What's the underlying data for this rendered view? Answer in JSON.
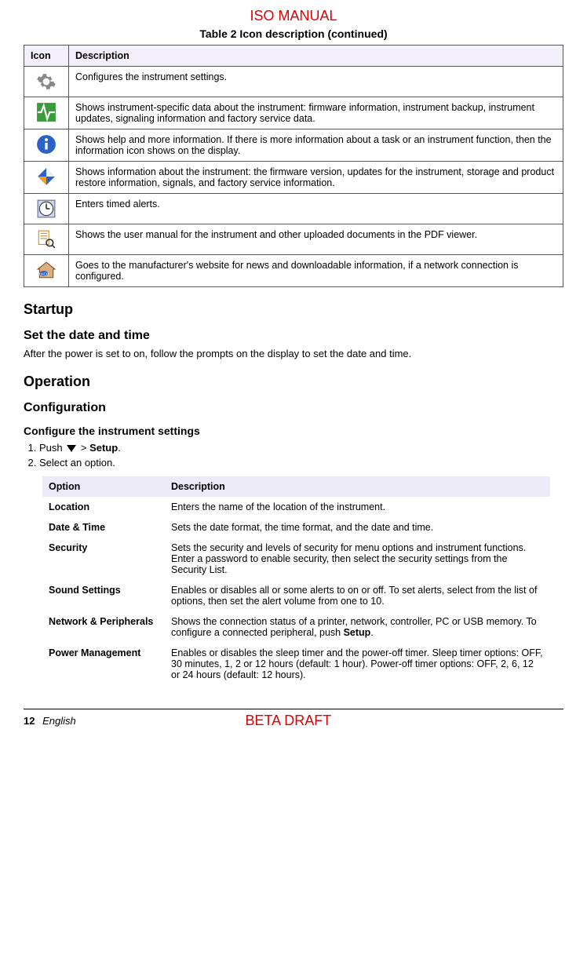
{
  "header": {
    "iso": "ISO MANUAL",
    "table_caption": "Table 2  Icon description (continued)"
  },
  "icon_table": {
    "headers": {
      "icon": "Icon",
      "desc": "Description"
    },
    "rows": [
      {
        "icon": "gear",
        "desc": "Configures the instrument settings."
      },
      {
        "icon": "activity",
        "desc": "Shows instrument-specific data about the instrument: firmware information, instrument backup, instrument updates, signaling information and factory service data."
      },
      {
        "icon": "info",
        "desc": "Shows help and more information. If there is more information about a task or an instrument function, then the information icon shows on the display."
      },
      {
        "icon": "diamond",
        "desc": "Shows information about the instrument: the firmware version, updates for the instrument, storage and product restore information, signals, and factory service information."
      },
      {
        "icon": "clock",
        "desc": "Enters timed alerts."
      },
      {
        "icon": "doc-search",
        "desc": "Shows the user manual for the instrument and other uploaded documents in the PDF viewer."
      },
      {
        "icon": "home",
        "desc": "Goes to the manufacturer's website for news and downloadable information, if a network connection is configured."
      }
    ]
  },
  "sections": {
    "startup": "Startup",
    "set_date_time": "Set the date and time",
    "set_date_time_body": "After the power is set to on, follow the prompts on the display to set the date and time.",
    "operation": "Operation",
    "configuration": "Configuration",
    "configure_settings": "Configure the instrument settings"
  },
  "steps": {
    "s1_pre": "Push ",
    "s1_post": " > ",
    "s1_bold": "Setup",
    "s1_end": ".",
    "s2": "Select an option."
  },
  "option_table": {
    "headers": {
      "option": "Option",
      "desc": "Description"
    },
    "rows": [
      {
        "option": "Location",
        "desc": "Enters the name of the location of the instrument."
      },
      {
        "option": "Date & Time",
        "desc": "Sets the date format, the time format, and the date and time."
      },
      {
        "option": "Security",
        "desc": "Sets the security and levels of security for menu options and instrument functions. Enter a password to enable security, then select the security settings from the Security List."
      },
      {
        "option": "Sound Settings",
        "desc": "Enables or disables all or some alerts to on or off. To set alerts, select from the list of options, then set the alert volume from one to 10."
      },
      {
        "option": "Network & Peripherals",
        "desc_pre": "Shows the connection status of a printer, network, controller, PC or USB memory. To configure a connected peripheral, push ",
        "desc_bold": "Setup",
        "desc_post": "."
      },
      {
        "option": "Power Management",
        "desc": "Enables or disables the sleep timer and the power-off timer. Sleep timer options: OFF, 30 minutes, 1, 2 or 12 hours (default: 1 hour). Power-off timer options: OFF, 2, 6, 12 or 24 hours (default: 12 hours)."
      }
    ]
  },
  "footer": {
    "page": "12",
    "lang": "English",
    "draft": "BETA DRAFT"
  }
}
